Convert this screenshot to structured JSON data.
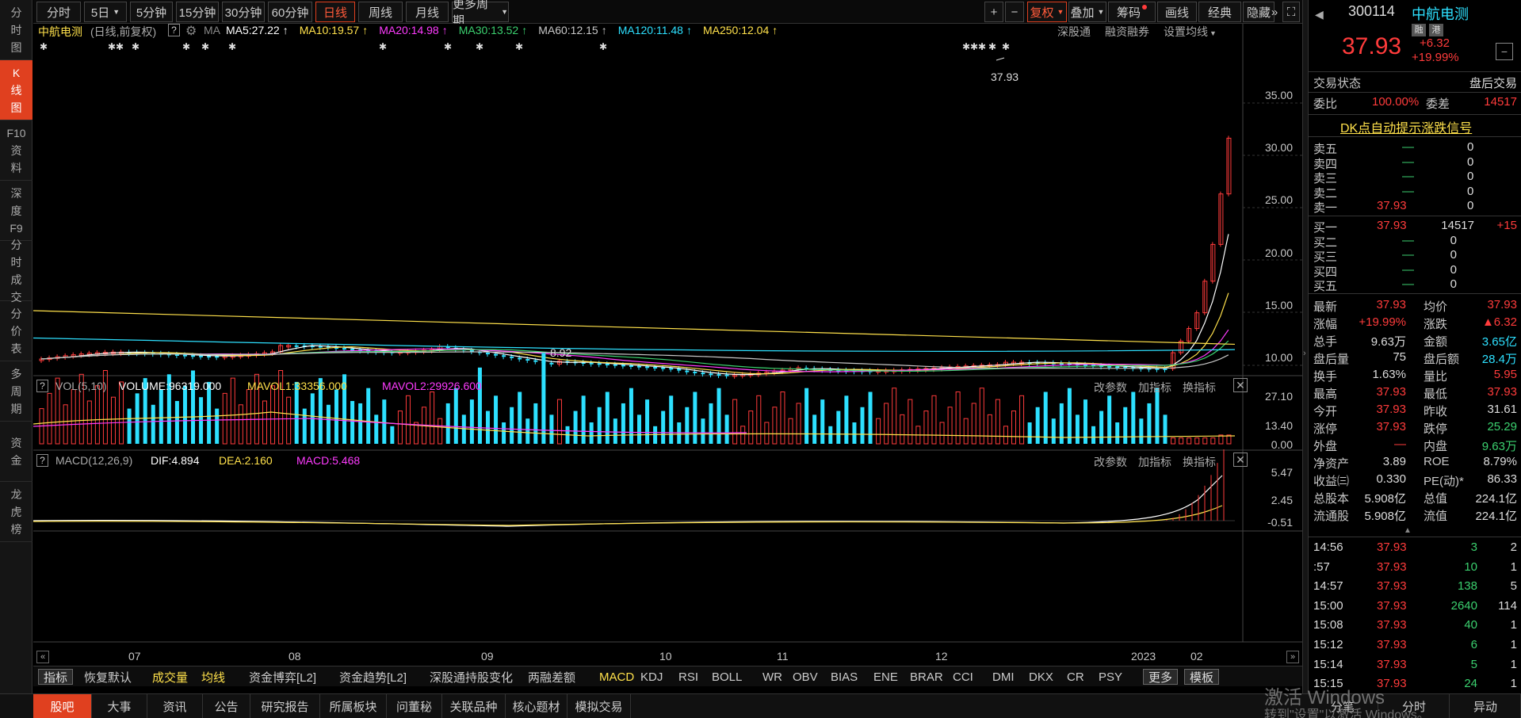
{
  "left_nav": [
    {
      "id": "intraday",
      "chars": [
        "分",
        "时",
        "图"
      ],
      "active": false
    },
    {
      "id": "kline",
      "chars": [
        "K",
        "线",
        "图"
      ],
      "active": true
    },
    {
      "id": "f10",
      "chars": [
        "F10",
        "资",
        "料"
      ],
      "active": false
    },
    {
      "id": "depth",
      "chars": [
        "深",
        "度",
        "F9"
      ],
      "active": false
    },
    {
      "id": "ticks",
      "chars": [
        "分",
        "时",
        "成",
        "交"
      ],
      "active": false
    },
    {
      "id": "pricetable",
      "chars": [
        "分",
        "价",
        "表"
      ],
      "active": false
    },
    {
      "id": "multi",
      "chars": [
        "多",
        "周",
        "期"
      ],
      "active": false
    },
    {
      "id": "fund",
      "chars": [
        "资",
        "金"
      ],
      "active": false
    },
    {
      "id": "dragon",
      "chars": [
        "龙",
        "虎",
        "榜"
      ],
      "active": false
    }
  ],
  "toolbar": {
    "periods": [
      {
        "label": "分时",
        "dropdown": false
      },
      {
        "label": "5日",
        "dropdown": true
      },
      {
        "label": "5分钟",
        "dropdown": false
      },
      {
        "label": "15分钟",
        "dropdown": false
      },
      {
        "label": "30分钟",
        "dropdown": false
      },
      {
        "label": "60分钟",
        "dropdown": false
      },
      {
        "label": "日线",
        "dropdown": false,
        "active": true
      },
      {
        "label": "周线",
        "dropdown": false
      },
      {
        "label": "月线",
        "dropdown": false
      },
      {
        "label": "更多周期",
        "dropdown": true
      }
    ],
    "right": [
      {
        "label": "+"
      },
      {
        "label": "−"
      },
      {
        "label": "复权",
        "dropdown": true,
        "active": true
      },
      {
        "label": "叠加",
        "dropdown": true
      },
      {
        "label": "筹码",
        "dot": true
      },
      {
        "label": "画线"
      },
      {
        "label": "经典"
      },
      {
        "label": "隐藏"
      }
    ],
    "arrows": "»",
    "expand": "⛶"
  },
  "kline": {
    "stock_name": "中航电测",
    "mode": "(日线,前复权)",
    "help": "?",
    "ma_label": "MA",
    "ma": [
      {
        "text": "MA5:27.22",
        "color": "#ffffff"
      },
      {
        "text": "MA10:19.57",
        "color": "#ffe14b"
      },
      {
        "text": "MA20:14.98",
        "color": "#ff3bff"
      },
      {
        "text": "MA30:13.52",
        "color": "#3bd16f"
      },
      {
        "text": "MA60:12.15",
        "color": "#c8c8c8"
      },
      {
        "text": "MA120:11.48",
        "color": "#2de0ff"
      },
      {
        "text": "MA250:12.04",
        "color": "#ffe14b"
      }
    ],
    "links": [
      "深股通",
      "融资融券",
      "设置均线"
    ],
    "last_price_label": "37.93",
    "low_label": "8.92",
    "y_axis": [
      "35.00",
      "30.00",
      "25.00",
      "20.00",
      "15.00",
      "10.00"
    ]
  },
  "volume": {
    "title": "VOL(5,10)",
    "volume": "VOLUME:96319.000",
    "mavol1": "MAVOL1:33356.000",
    "mavol2": "MAVOL2:29926.600",
    "y_axis": [
      "27.10",
      "13.40",
      "0.00"
    ],
    "links": [
      "改参数",
      "加指标",
      "换指标"
    ]
  },
  "macd": {
    "title": "MACD(12,26,9)",
    "dif": "DIF:4.894",
    "dea": "DEA:2.160",
    "macd": "MACD:5.468",
    "y_axis": [
      "5.47",
      "2.45",
      "-0.51"
    ],
    "links": [
      "改参数",
      "加指标",
      "换指标"
    ]
  },
  "x_axis": [
    "07",
    "08",
    "09",
    "10",
    "11",
    "12",
    "2023",
    "02"
  ],
  "indicators": [
    {
      "label": "指标",
      "style": "box"
    },
    {
      "label": "恢复默认"
    },
    {
      "label": "成交量",
      "style": "hl"
    },
    {
      "label": "均线",
      "style": "hl"
    },
    {
      "label": "资金博弈[L2]"
    },
    {
      "label": "资金趋势[L2]"
    },
    {
      "label": "深股通持股变化"
    },
    {
      "label": "两融差额"
    },
    {
      "label": "MACD",
      "style": "hl"
    },
    {
      "label": "KDJ"
    },
    {
      "label": "RSI"
    },
    {
      "label": "BOLL"
    },
    {
      "label": "WR"
    },
    {
      "label": "OBV"
    },
    {
      "label": "BIAS"
    },
    {
      "label": "ENE"
    },
    {
      "label": "BRAR"
    },
    {
      "label": "CCI"
    },
    {
      "label": "DMI"
    },
    {
      "label": "DKX"
    },
    {
      "label": "CR"
    },
    {
      "label": "PSY"
    },
    {
      "label": "更多",
      "style": "box"
    },
    {
      "label": "模板",
      "style": "box"
    }
  ],
  "bottom_tabs": [
    "股吧",
    "大事",
    "资讯",
    "公告",
    "研究报告",
    "所属板块",
    "问董秘",
    "关联品种",
    "核心题材",
    "模拟交易"
  ],
  "bottom_right_tabs": [
    "分笔",
    "分时",
    "异动"
  ],
  "watermark": "激活 Windows",
  "watermark_sub": "转到\"设置\"以激活 Windows。",
  "quote": {
    "code": "300114",
    "name": "中航电测",
    "price": "37.93",
    "change": "+6.32",
    "change_pct": "+19.99%",
    "badges": [
      "融",
      "港"
    ],
    "status_label": "交易状态",
    "status_value": "盘后交易",
    "weibi_label": "委比",
    "weibi_value": "100.00%",
    "weicha_label": "委差",
    "weicha_value": "14517",
    "signal": "DK点自动提示涨跌信号",
    "sell": [
      {
        "label": "卖五",
        "price": "—",
        "vol": "0"
      },
      {
        "label": "卖四",
        "price": "—",
        "vol": "0"
      },
      {
        "label": "卖三",
        "price": "—",
        "vol": "0"
      },
      {
        "label": "卖二",
        "price": "—",
        "vol": "0"
      },
      {
        "label": "卖一",
        "price": "37.93",
        "vol": "0"
      }
    ],
    "buy": [
      {
        "label": "买一",
        "price": "37.93",
        "vol": "14517",
        "delta": "+15"
      },
      {
        "label": "买二",
        "price": "—",
        "vol": "0",
        "delta": ""
      },
      {
        "label": "买三",
        "price": "—",
        "vol": "0",
        "delta": ""
      },
      {
        "label": "买四",
        "price": "—",
        "vol": "0",
        "delta": ""
      },
      {
        "label": "买五",
        "price": "—",
        "vol": "0",
        "delta": ""
      }
    ],
    "stats": [
      {
        "l1": "最新",
        "v1": "37.93",
        "c1": "red",
        "l2": "均价",
        "v2": "37.93",
        "c2": "red"
      },
      {
        "l1": "涨幅",
        "v1": "+19.99%",
        "c1": "red",
        "l2": "涨跌",
        "v2": "▲6.32",
        "c2": "red"
      },
      {
        "l1": "总手",
        "v1": "9.63万",
        "c1": "white",
        "l2": "金额",
        "v2": "3.65亿",
        "c2": "cyan"
      },
      {
        "l1": "盘后量",
        "v1": "75",
        "c1": "white",
        "l2": "盘后额",
        "v2": "28.4万",
        "c2": "cyan"
      },
      {
        "l1": "换手",
        "v1": "1.63%",
        "c1": "white",
        "l2": "量比",
        "v2": "5.95",
        "c2": "red"
      },
      {
        "l1": "最高",
        "v1": "37.93",
        "c1": "red",
        "l2": "最低",
        "v2": "37.93",
        "c2": "red"
      },
      {
        "l1": "今开",
        "v1": "37.93",
        "c1": "red",
        "l2": "昨收",
        "v2": "31.61",
        "c2": "white"
      },
      {
        "l1": "涨停",
        "v1": "37.93",
        "c1": "red",
        "l2": "跌停",
        "v2": "25.29",
        "c2": "green"
      },
      {
        "l1": "外盘",
        "v1": "—",
        "c1": "red",
        "l2": "内盘",
        "v2": "9.63万",
        "c2": "green"
      },
      {
        "l1": "净资产",
        "v1": "3.89",
        "c1": "white",
        "l2": "ROE",
        "v2": "8.79%",
        "c2": "white"
      },
      {
        "l1": "收益㈢",
        "v1": "0.330",
        "c1": "white",
        "l2": "PE(动)*",
        "v2": "86.33",
        "c2": "white"
      },
      {
        "l1": "总股本",
        "v1": "5.908亿",
        "c1": "white",
        "l2": "总值",
        "v2": "224.1亿",
        "c2": "white"
      },
      {
        "l1": "流通股",
        "v1": "5.908亿",
        "c1": "white",
        "l2": "流值",
        "v2": "224.1亿",
        "c2": "white"
      }
    ],
    "ticks": [
      {
        "t": "14:56",
        "p": "37.93",
        "v": "3",
        "n": "2"
      },
      {
        "t": ":57",
        "p": "37.93",
        "v": "10",
        "n": "1"
      },
      {
        "t": "14:57",
        "p": "37.93",
        "v": "138",
        "n": "5"
      },
      {
        "t": "15:00",
        "p": "37.93",
        "v": "2640",
        "n": "114"
      },
      {
        "t": "15:08",
        "p": "37.93",
        "v": "40",
        "n": "1"
      },
      {
        "t": "15:12",
        "p": "37.93",
        "v": "6",
        "n": "1"
      },
      {
        "t": "15:14",
        "p": "37.93",
        "v": "5",
        "n": "1"
      },
      {
        "t": "15:15",
        "p": "37.93",
        "v": "24",
        "n": "1"
      }
    ]
  },
  "colors": {
    "up": "#ff3b3b",
    "down": "#2de0ff",
    "accent": "#e0401f"
  }
}
